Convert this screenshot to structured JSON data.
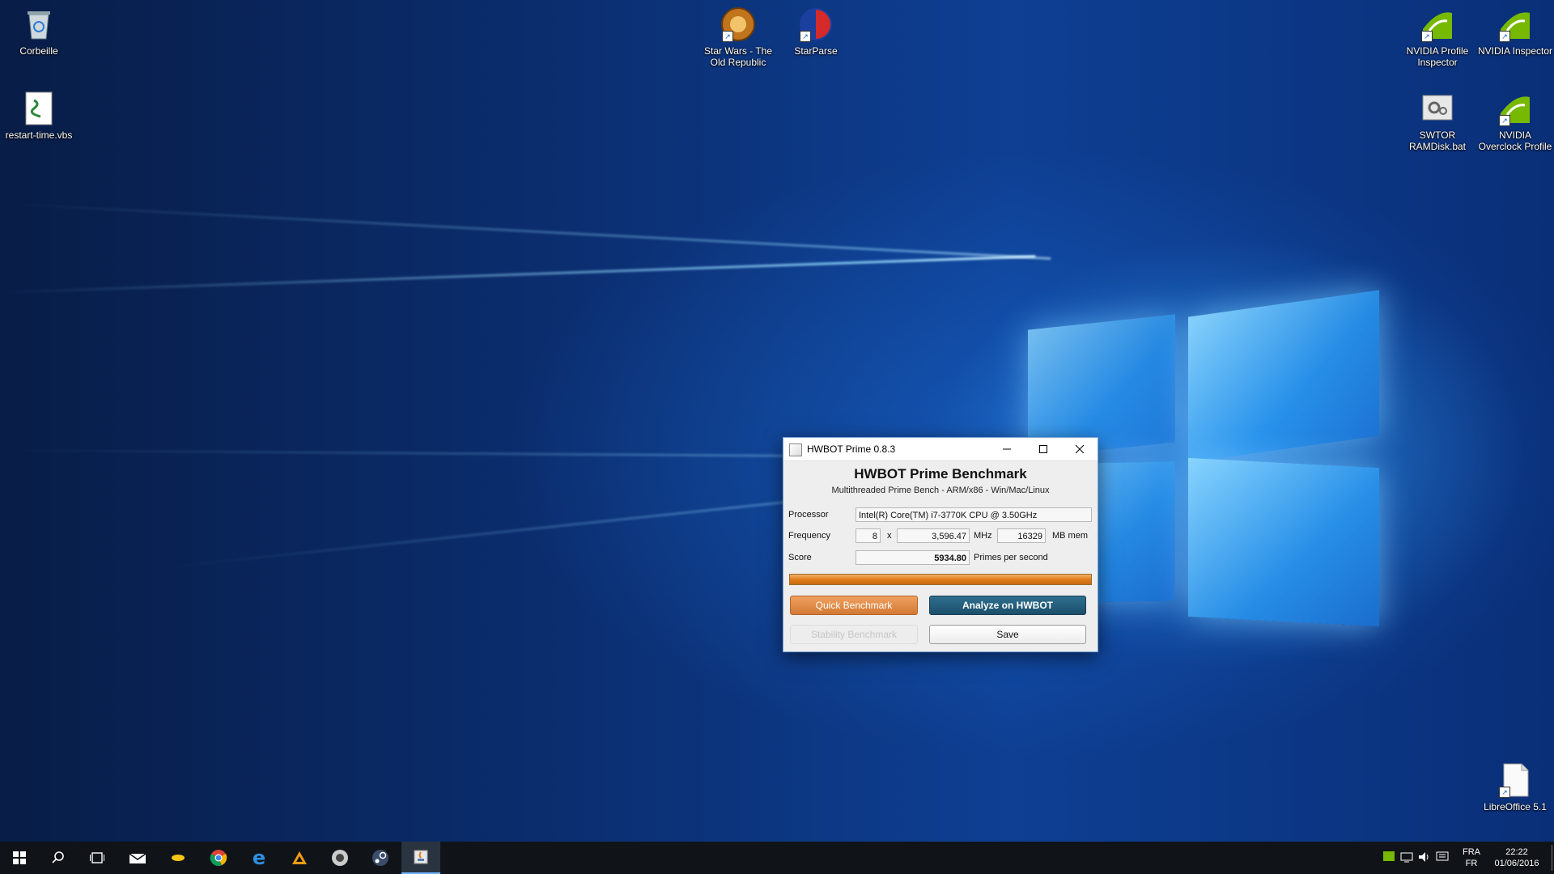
{
  "desktop": {
    "icons": [
      {
        "label": "Corbeille",
        "icon": "recycle-bin-icon"
      },
      {
        "label": "restart-time.vbs",
        "icon": "script-file-icon"
      },
      {
        "label": "Star Wars - The Old Republic",
        "icon": "swtor-icon"
      },
      {
        "label": "StarParse",
        "icon": "starparse-icon"
      },
      {
        "label": "NVIDIA Profile Inspector",
        "icon": "nvidia-icon"
      },
      {
        "label": "NVIDIA Inspector",
        "icon": "nvidia-icon"
      },
      {
        "label": "SWTOR RAMDisk.bat",
        "icon": "batch-file-icon"
      },
      {
        "label": "NVIDIA Overclock Profile",
        "icon": "nvidia-icon"
      },
      {
        "label": "LibreOffice 5.1",
        "icon": "libreoffice-icon"
      }
    ]
  },
  "window": {
    "title": "HWBOT Prime 0.8.3",
    "heading": "HWBOT Prime Benchmark",
    "subheading": "Multithreaded Prime Bench - ARM/x86 - Win/Mac/Linux",
    "processor_label": "Processor",
    "processor_value": "Intel(R) Core(TM) i7-3770K CPU @ 3.50GHz",
    "frequency_label": "Frequency",
    "cores": "8",
    "times": "x",
    "frequency_value": "3,596.47",
    "mhz": "MHz",
    "memory_value": "16329",
    "mem_unit": "MB mem",
    "score_label": "Score",
    "score_value": "5934.80",
    "score_unit": "Primes per second",
    "progress": 1.0,
    "quick_benchmark": "Quick Benchmark",
    "analyze": "Analyze on HWBOT",
    "stability_benchmark": "Stability Benchmark",
    "save": "Save"
  },
  "taskbar": {
    "lang_top": "FRA",
    "lang_bottom": "FR",
    "time": "22:22",
    "date": "01/06/2016"
  },
  "colors": {
    "accent_orange": "#e07d1a",
    "analyze_blue": "#1b4f6b",
    "taskbar": "#101418"
  }
}
